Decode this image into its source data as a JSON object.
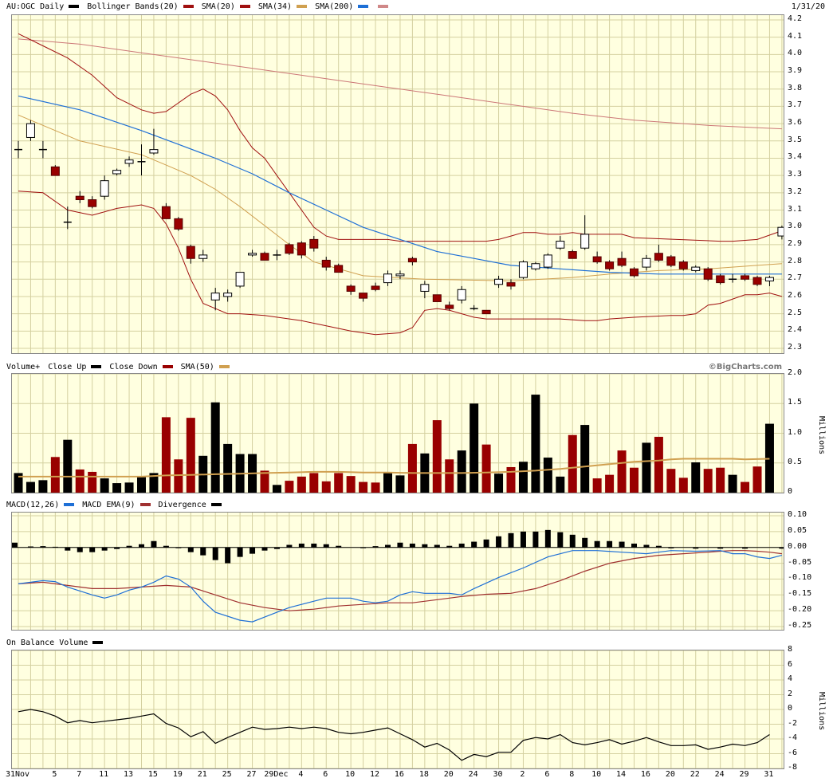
{
  "colors": {
    "up": "#000000",
    "down": "#990000",
    "bb": "#a01010",
    "sma20": "#a01010",
    "sma34": "#d0a050",
    "sma200": "#cc7777",
    "macd": "#1e6fd6",
    "ema": "#a03030",
    "grid": "#d4d0a0",
    "bg": "#ffffe0"
  },
  "header": {
    "symbol": "AU:OGC Daily",
    "bollinger": "Bollinger Bands(20)",
    "sma20": "SMA(20)",
    "sma34": "SMA(34)",
    "sma200": "SMA(200)",
    "date": "1/31/20"
  },
  "volume_header": {
    "title": "Volume+",
    "close_up": "Close Up",
    "close_down": "Close Down",
    "sma50": "SMA(50)",
    "watermark": "©BigCharts.com"
  },
  "macd_header": {
    "macd": "MACD(12,26)",
    "ema": "MACD EMA(9)",
    "div": "Divergence"
  },
  "obv_header": {
    "title": "On Balance Volume"
  },
  "chart_data": {
    "type": "candlestick",
    "price_ylim": [
      2.3,
      4.2
    ],
    "price_ticks": [
      "4.2",
      "4.1",
      "4.0",
      "3.9",
      "3.8",
      "3.7",
      "3.6",
      "3.5",
      "3.4",
      "3.3",
      "3.2",
      "3.1",
      "3.0",
      "2.9",
      "2.8",
      "2.7",
      "2.6",
      "2.5",
      "2.4",
      "2.3"
    ],
    "x_ticks": [
      {
        "i": 0,
        "label": "31Nov"
      },
      {
        "i": 3,
        "label": "5"
      },
      {
        "i": 5,
        "label": "7"
      },
      {
        "i": 7,
        "label": "11"
      },
      {
        "i": 9,
        "label": "13"
      },
      {
        "i": 11,
        "label": "15"
      },
      {
        "i": 13,
        "label": "19"
      },
      {
        "i": 15,
        "label": "21"
      },
      {
        "i": 17,
        "label": "25"
      },
      {
        "i": 19,
        "label": "27"
      },
      {
        "i": 21,
        "label": "29Dec"
      },
      {
        "i": 23,
        "label": "4"
      },
      {
        "i": 25,
        "label": "6"
      },
      {
        "i": 27,
        "label": "10"
      },
      {
        "i": 29,
        "label": "12"
      },
      {
        "i": 31,
        "label": "16"
      },
      {
        "i": 33,
        "label": "18"
      },
      {
        "i": 35,
        "label": "20"
      },
      {
        "i": 37,
        "label": "24"
      },
      {
        "i": 39,
        "label": "30"
      },
      {
        "i": 41,
        "label": "2"
      },
      {
        "i": 43,
        "label": "6"
      },
      {
        "i": 45,
        "label": "8"
      },
      {
        "i": 47,
        "label": "10"
      },
      {
        "i": 49,
        "label": "14"
      },
      {
        "i": 51,
        "label": "16"
      },
      {
        "i": 53,
        "label": "20"
      },
      {
        "i": 55,
        "label": "22"
      },
      {
        "i": 57,
        "label": "24"
      },
      {
        "i": 59,
        "label": "29"
      },
      {
        "i": 61,
        "label": "31"
      }
    ],
    "candles": [
      [
        3.45,
        3.5,
        3.4,
        3.45
      ],
      [
        3.52,
        3.62,
        3.5,
        3.6
      ],
      [
        3.45,
        3.5,
        3.4,
        3.45
      ],
      [
        3.35,
        3.36,
        3.3,
        3.3
      ],
      [
        3.03,
        3.12,
        2.99,
        3.03
      ],
      [
        3.18,
        3.21,
        3.14,
        3.16
      ],
      [
        3.16,
        3.18,
        3.11,
        3.12
      ],
      [
        3.18,
        3.3,
        3.16,
        3.27
      ],
      [
        3.31,
        3.34,
        3.3,
        3.33
      ],
      [
        3.37,
        3.41,
        3.35,
        3.39
      ],
      [
        3.38,
        3.48,
        3.3,
        3.38
      ],
      [
        3.43,
        3.57,
        3.42,
        3.45
      ],
      [
        3.12,
        3.14,
        3.05,
        3.05
      ],
      [
        3.05,
        3.06,
        2.98,
        2.99
      ],
      [
        2.89,
        2.9,
        2.79,
        2.82
      ],
      [
        2.82,
        2.87,
        2.8,
        2.84
      ],
      [
        2.58,
        2.65,
        2.52,
        2.62
      ],
      [
        2.6,
        2.64,
        2.57,
        2.62
      ],
      [
        2.66,
        2.74,
        2.65,
        2.74
      ],
      [
        2.84,
        2.87,
        2.83,
        2.85
      ],
      [
        2.85,
        2.86,
        2.81,
        2.81
      ],
      [
        2.84,
        2.87,
        2.81,
        2.84
      ],
      [
        2.9,
        2.91,
        2.84,
        2.85
      ],
      [
        2.91,
        2.92,
        2.82,
        2.84
      ],
      [
        2.93,
        2.95,
        2.86,
        2.88
      ],
      [
        2.81,
        2.83,
        2.75,
        2.77
      ],
      [
        2.78,
        2.79,
        2.74,
        2.74
      ],
      [
        2.66,
        2.67,
        2.61,
        2.63
      ],
      [
        2.62,
        2.62,
        2.57,
        2.59
      ],
      [
        2.66,
        2.68,
        2.63,
        2.64
      ],
      [
        2.68,
        2.75,
        2.66,
        2.73
      ],
      [
        2.72,
        2.75,
        2.7,
        2.73
      ],
      [
        2.82,
        2.83,
        2.78,
        2.8
      ],
      [
        2.63,
        2.69,
        2.59,
        2.67
      ],
      [
        2.61,
        2.61,
        2.57,
        2.57
      ],
      [
        2.55,
        2.57,
        2.52,
        2.53
      ],
      [
        2.58,
        2.66,
        2.56,
        2.64
      ],
      [
        2.53,
        2.55,
        2.52,
        2.53
      ],
      [
        2.52,
        2.52,
        2.5,
        2.5
      ],
      [
        2.67,
        2.72,
        2.65,
        2.7
      ],
      [
        2.68,
        2.7,
        2.64,
        2.66
      ],
      [
        2.71,
        2.81,
        2.7,
        2.8
      ],
      [
        2.76,
        2.8,
        2.75,
        2.79
      ],
      [
        2.77,
        2.85,
        2.76,
        2.84
      ],
      [
        2.88,
        2.95,
        2.87,
        2.92
      ],
      [
        2.86,
        2.87,
        2.82,
        2.82
      ],
      [
        2.88,
        3.07,
        2.87,
        2.96
      ],
      [
        2.83,
        2.86,
        2.79,
        2.8
      ],
      [
        2.8,
        2.81,
        2.75,
        2.76
      ],
      [
        2.82,
        2.86,
        2.77,
        2.78
      ],
      [
        2.76,
        2.77,
        2.71,
        2.72
      ],
      [
        2.77,
        2.84,
        2.75,
        2.82
      ],
      [
        2.85,
        2.9,
        2.8,
        2.81
      ],
      [
        2.83,
        2.84,
        2.77,
        2.78
      ],
      [
        2.8,
        2.81,
        2.75,
        2.76
      ],
      [
        2.75,
        2.78,
        2.74,
        2.77
      ],
      [
        2.76,
        2.77,
        2.69,
        2.7
      ],
      [
        2.72,
        2.73,
        2.67,
        2.68
      ],
      [
        2.7,
        2.73,
        2.68,
        2.7
      ],
      [
        2.72,
        2.73,
        2.69,
        2.7
      ],
      [
        2.71,
        2.72,
        2.66,
        2.67
      ],
      [
        2.69,
        2.72,
        2.66,
        2.71
      ],
      [
        2.95,
        3.01,
        2.93,
        3.0
      ]
    ],
    "bb_upper": [
      4.12,
      4.05,
      3.98,
      3.88,
      3.75,
      3.68,
      3.66,
      3.67,
      3.72,
      3.77,
      3.8,
      3.76,
      3.68,
      3.56,
      3.46,
      3.4,
      3.3,
      3.2,
      3.1,
      3.0,
      2.95,
      2.93,
      2.93,
      2.93,
      2.93,
      2.93,
      2.92,
      2.92,
      2.92,
      2.92,
      2.92,
      2.92,
      2.92,
      2.92,
      2.93,
      2.95,
      2.97,
      2.97,
      2.96,
      2.96,
      2.97,
      2.96,
      2.96,
      2.96,
      2.96,
      2.94,
      2.92,
      2.92,
      2.93,
      2.98
    ],
    "bb_upper_idx": [
      0,
      2,
      4,
      6,
      8,
      10,
      11,
      12,
      13,
      14,
      15,
      16,
      17,
      18,
      19,
      20,
      21,
      22,
      23,
      24,
      25,
      26,
      27,
      28,
      29,
      30,
      31,
      32,
      33,
      34,
      35,
      36,
      37,
      38,
      39,
      40,
      41,
      42,
      43,
      44,
      45,
      46,
      47,
      48,
      49,
      50,
      57,
      58,
      60,
      62
    ],
    "sma200": [
      4.09,
      4.06,
      4.01,
      3.96,
      3.91,
      3.86,
      3.81,
      3.76,
      3.71,
      3.66,
      3.62,
      3.59,
      3.57
    ],
    "sma200_idx": [
      0,
      5,
      10,
      15,
      20,
      25,
      30,
      35,
      40,
      45,
      50,
      56,
      62
    ],
    "sma34": [
      3.65,
      3.5,
      3.42,
      3.36,
      3.3,
      3.22,
      3.12,
      3.01,
      2.9,
      2.8,
      2.72,
      2.7,
      2.69,
      2.71,
      2.73,
      2.75,
      2.76,
      2.78,
      2.79
    ],
    "sma34_idx": [
      0,
      5,
      10,
      12,
      14,
      16,
      18,
      20,
      22,
      24,
      28,
      33,
      40,
      45,
      48,
      52,
      56,
      60,
      62
    ],
    "sma20": [
      3.76,
      3.68,
      3.56,
      3.48,
      3.4,
      3.31,
      3.2,
      3.1,
      3.0,
      2.93,
      2.86,
      2.82,
      2.78,
      2.76,
      2.74,
      2.73,
      2.73,
      2.73
    ],
    "sma20_idx": [
      0,
      5,
      10,
      13,
      16,
      19,
      22,
      25,
      28,
      31,
      34,
      37,
      40,
      44,
      48,
      52,
      57,
      62
    ],
    "bb_lower": [
      3.21,
      3.2,
      3.1,
      3.07,
      3.11,
      3.13,
      3.11,
      3.02,
      2.88,
      2.7,
      2.56,
      2.53,
      2.5,
      2.5,
      2.49,
      2.46,
      2.43,
      2.4,
      2.38,
      2.39,
      2.42,
      2.52,
      2.53,
      2.52,
      2.5,
      2.48,
      2.47,
      2.47,
      2.47,
      2.47,
      2.46,
      2.46,
      2.47,
      2.48,
      2.49,
      2.49,
      2.5,
      2.55,
      2.56,
      2.61,
      2.61,
      2.62,
      2.6
    ],
    "bb_lower_idx": [
      0,
      2,
      4,
      6,
      8,
      10,
      11,
      12,
      13,
      14,
      15,
      16,
      17,
      18,
      20,
      23,
      25,
      27,
      29,
      31,
      32,
      33,
      34,
      35,
      36,
      37,
      38,
      40,
      42,
      44,
      46,
      47,
      48,
      50,
      53,
      54,
      55,
      56,
      57,
      59,
      60,
      61,
      62
    ],
    "volume_ylim": [
      0,
      2.0
    ],
    "volume_ticks": [
      "2.0",
      "1.5",
      "1.0",
      "0.5",
      "0"
    ],
    "volume_unit": "Millions",
    "volume": [
      0.33,
      0.18,
      0.21,
      0.6,
      0.89,
      0.39,
      0.35,
      0.24,
      0.16,
      0.17,
      0.26,
      0.33,
      1.27,
      0.56,
      1.26,
      0.62,
      1.52,
      0.82,
      0.65,
      0.65,
      0.37,
      0.13,
      0.2,
      0.27,
      0.33,
      0.19,
      0.33,
      0.28,
      0.18,
      0.17,
      0.33,
      0.29,
      0.82,
      0.66,
      1.22,
      0.56,
      0.71,
      1.5,
      0.81,
      0.32,
      0.43,
      0.52,
      1.65,
      0.59,
      0.27,
      0.97,
      1.14,
      0.24,
      0.3,
      0.71,
      0.42,
      0.84,
      0.94,
      0.4,
      0.25,
      0.51,
      0.4,
      0.42,
      0.3,
      0.18,
      0.44,
      1.16
    ],
    "vol_sma50": [
      0.27,
      0.27,
      0.27,
      0.29,
      0.3,
      0.31,
      0.32,
      0.33,
      0.34,
      0.35,
      0.35,
      0.34,
      0.34,
      0.33,
      0.33,
      0.33,
      0.33,
      0.34,
      0.35,
      0.37,
      0.4,
      0.44,
      0.48,
      0.52,
      0.54,
      0.56,
      0.57,
      0.57,
      0.57,
      0.57,
      0.57,
      0.56,
      0.57
    ],
    "vol_sma50_idx": [
      0,
      5,
      10,
      12,
      14,
      16,
      18,
      20,
      22,
      24,
      26,
      28,
      30,
      32,
      33,
      34,
      36,
      38,
      40,
      42,
      44,
      46,
      48,
      50,
      52,
      53,
      54,
      55,
      56,
      57,
      58,
      59,
      61
    ],
    "macd_ylim": [
      -0.26,
      0.11
    ],
    "macd_ticks": [
      "0.10",
      "0.05",
      "0.00",
      "-0.05",
      "-0.10",
      "-0.15",
      "-0.20",
      "-0.25"
    ],
    "macd": [
      -0.115,
      -0.105,
      -0.108,
      -0.125,
      -0.15,
      -0.16,
      -0.15,
      -0.135,
      -0.125,
      -0.11,
      -0.09,
      -0.1,
      -0.125,
      -0.17,
      -0.205,
      -0.23,
      -0.235,
      -0.22,
      -0.205,
      -0.19,
      -0.18,
      -0.17,
      -0.16,
      -0.16,
      -0.17,
      -0.175,
      -0.17,
      -0.15,
      -0.14,
      -0.145,
      -0.145,
      -0.15,
      -0.13,
      -0.095,
      -0.065,
      -0.03,
      -0.01,
      -0.01,
      -0.015,
      -0.02,
      -0.01,
      -0.012,
      -0.01,
      -0.02,
      -0.02,
      -0.03,
      -0.035,
      -0.025,
      -0.005
    ],
    "macd_idx": [
      0,
      2,
      3,
      4,
      6,
      7,
      8,
      9,
      10,
      11,
      12,
      13,
      14,
      15,
      16,
      18,
      19,
      20,
      21,
      22,
      23,
      24,
      25,
      27,
      28,
      29,
      30,
      31,
      32,
      33,
      35,
      36,
      37,
      39,
      41,
      43,
      45,
      47,
      49,
      51,
      53,
      55,
      57,
      58,
      59,
      60,
      61,
      62
    ],
    "macd_ema": [
      -0.115,
      -0.11,
      -0.12,
      -0.13,
      -0.13,
      -0.125,
      -0.12,
      -0.125,
      -0.15,
      -0.175,
      -0.19,
      -0.2,
      -0.195,
      -0.185,
      -0.18,
      -0.175,
      -0.175,
      -0.165,
      -0.155,
      -0.148,
      -0.145,
      -0.13,
      -0.105,
      -0.075,
      -0.05,
      -0.035,
      -0.025,
      -0.02,
      -0.015,
      -0.012,
      -0.01,
      -0.01,
      -0.012,
      -0.015,
      -0.02,
      -0.018
    ],
    "macd_ema_idx": [
      0,
      2,
      4,
      6,
      8,
      10,
      12,
      14,
      16,
      18,
      20,
      22,
      24,
      26,
      28,
      30,
      32,
      34,
      36,
      38,
      40,
      42,
      44,
      46,
      48,
      50,
      52,
      54,
      56,
      57,
      58,
      59,
      60,
      61,
      62
    ],
    "divergence": [
      0.003,
      0.004,
      0.002,
      -0.01,
      -0.015,
      -0.015,
      -0.01,
      -0.005,
      0.005,
      0.01,
      0.02,
      0.005,
      0.0,
      -0.015,
      -0.025,
      -0.04,
      -0.05,
      -0.03,
      -0.02,
      -0.01,
      -0.005,
      0.008,
      0.012,
      0.012,
      0.01,
      0.005,
      0.0,
      0.004,
      0.008,
      0.015,
      0.012,
      0.01,
      0.008,
      0.005,
      0.012,
      0.018,
      0.025,
      0.035,
      0.045,
      0.05,
      0.05,
      0.055,
      0.048,
      0.04,
      0.03,
      0.02,
      0.02,
      0.018,
      0.012,
      0.008,
      0.005,
      -0.003,
      -0.004,
      -0.004,
      -0.004,
      -0.004,
      0.015
    ],
    "divergence_idx": [
      1,
      2,
      3,
      4,
      5,
      6,
      7,
      8,
      9,
      10,
      11,
      12,
      13,
      14,
      15,
      16,
      17,
      18,
      19,
      20,
      21,
      22,
      23,
      24,
      25,
      26,
      28,
      29,
      30,
      31,
      32,
      33,
      34,
      35,
      36,
      37,
      38,
      39,
      40,
      41,
      42,
      43,
      44,
      45,
      46,
      47,
      48,
      49,
      50,
      51,
      52,
      53,
      55,
      57,
      59,
      62
    ],
    "obv_ylim": [
      -8,
      8
    ],
    "obv_ticks": [
      "8",
      "6",
      "4",
      "2",
      "0",
      "-2",
      "-4",
      "-6",
      "-8"
    ],
    "obv_unit": "Millions",
    "obv": [
      -0.3,
      0.0,
      -0.3,
      -0.9,
      -1.8,
      -1.5,
      -1.8,
      -1.6,
      -1.4,
      -1.2,
      -0.9,
      -0.6,
      -1.9,
      -2.5,
      -3.7,
      -3.0,
      -4.6,
      -3.8,
      -3.1,
      -2.4,
      -2.7,
      -2.6,
      -2.4,
      -2.6,
      -2.4,
      -2.6,
      -3.1,
      -3.3,
      -3.1,
      -2.8,
      -2.5,
      -3.3,
      -4.1,
      -5.1,
      -4.6,
      -5.5,
      -6.9,
      -6.1,
      -6.4,
      -5.8,
      -5.8,
      -4.2,
      -3.8,
      -4.0,
      -3.4,
      -4.5,
      -4.8,
      -4.5,
      -4.1,
      -4.7,
      -4.3,
      -3.8,
      -4.4,
      -4.9,
      -4.9,
      -4.8,
      -5.4,
      -5.1,
      -4.7,
      -4.9,
      -4.5,
      -3.4
    ],
    "obv_idx": [
      0,
      1,
      2,
      3,
      4,
      5,
      6,
      7,
      8,
      9,
      10,
      11,
      12,
      13,
      14,
      15,
      16,
      17,
      18,
      19,
      20,
      21,
      22,
      23,
      24,
      25,
      26,
      27,
      28,
      29,
      30,
      31,
      32,
      33,
      34,
      35,
      36,
      37,
      38,
      39,
      40,
      41,
      42,
      43,
      44,
      45,
      46,
      47,
      48,
      49,
      50,
      51,
      52,
      53,
      54,
      55,
      56,
      57,
      58,
      59,
      60,
      61
    ]
  }
}
